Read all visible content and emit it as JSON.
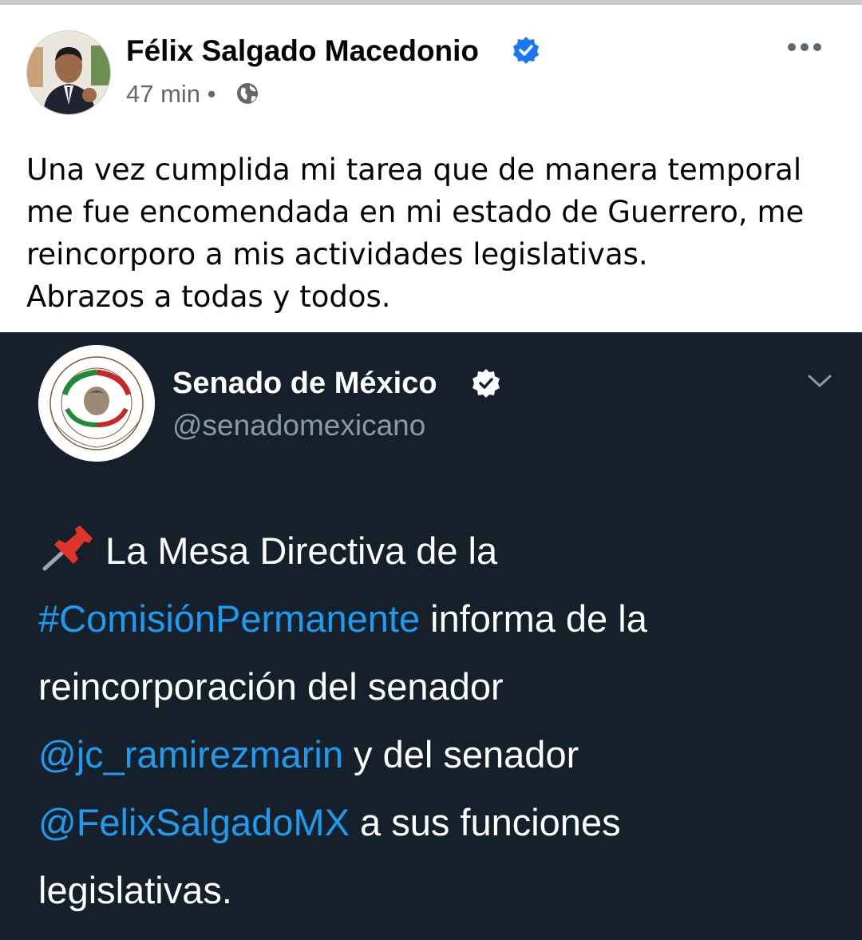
{
  "post": {
    "author": "Félix Salgado Macedonio",
    "time": "47 min",
    "separator": "•",
    "lines": [
      "Una vez cumplida mi tarea que de manera temporal",
      "me fue encomendada en mi estado de Guerrero, me",
      "reincorporo a mis actividades legislativas.",
      "Abrazos a todas y todos."
    ]
  },
  "embed": {
    "name": "Senado de México",
    "handle": "@senadomexicano",
    "tweet": {
      "l1": "La Mesa Directiva de la",
      "l2_link": "#ComisiónPermanente",
      "l2_text": " informa de la",
      "l3": "reincorporación del senador",
      "l4_link": "@jc_ramirezmarin",
      "l4_text": " y del senador",
      "l5_link": "@FelixSalgadoMX",
      "l5_text": " a sus funciones",
      "l6": "legislativas."
    }
  },
  "colors": {
    "fb_verified": "#1877f2",
    "embed_bg": "#15202b",
    "link": "#1d9bf0"
  },
  "icons": [
    "verified-badge-icon",
    "globe-icon",
    "more-options-icon",
    "chevron-down-icon",
    "pushpin-icon"
  ]
}
